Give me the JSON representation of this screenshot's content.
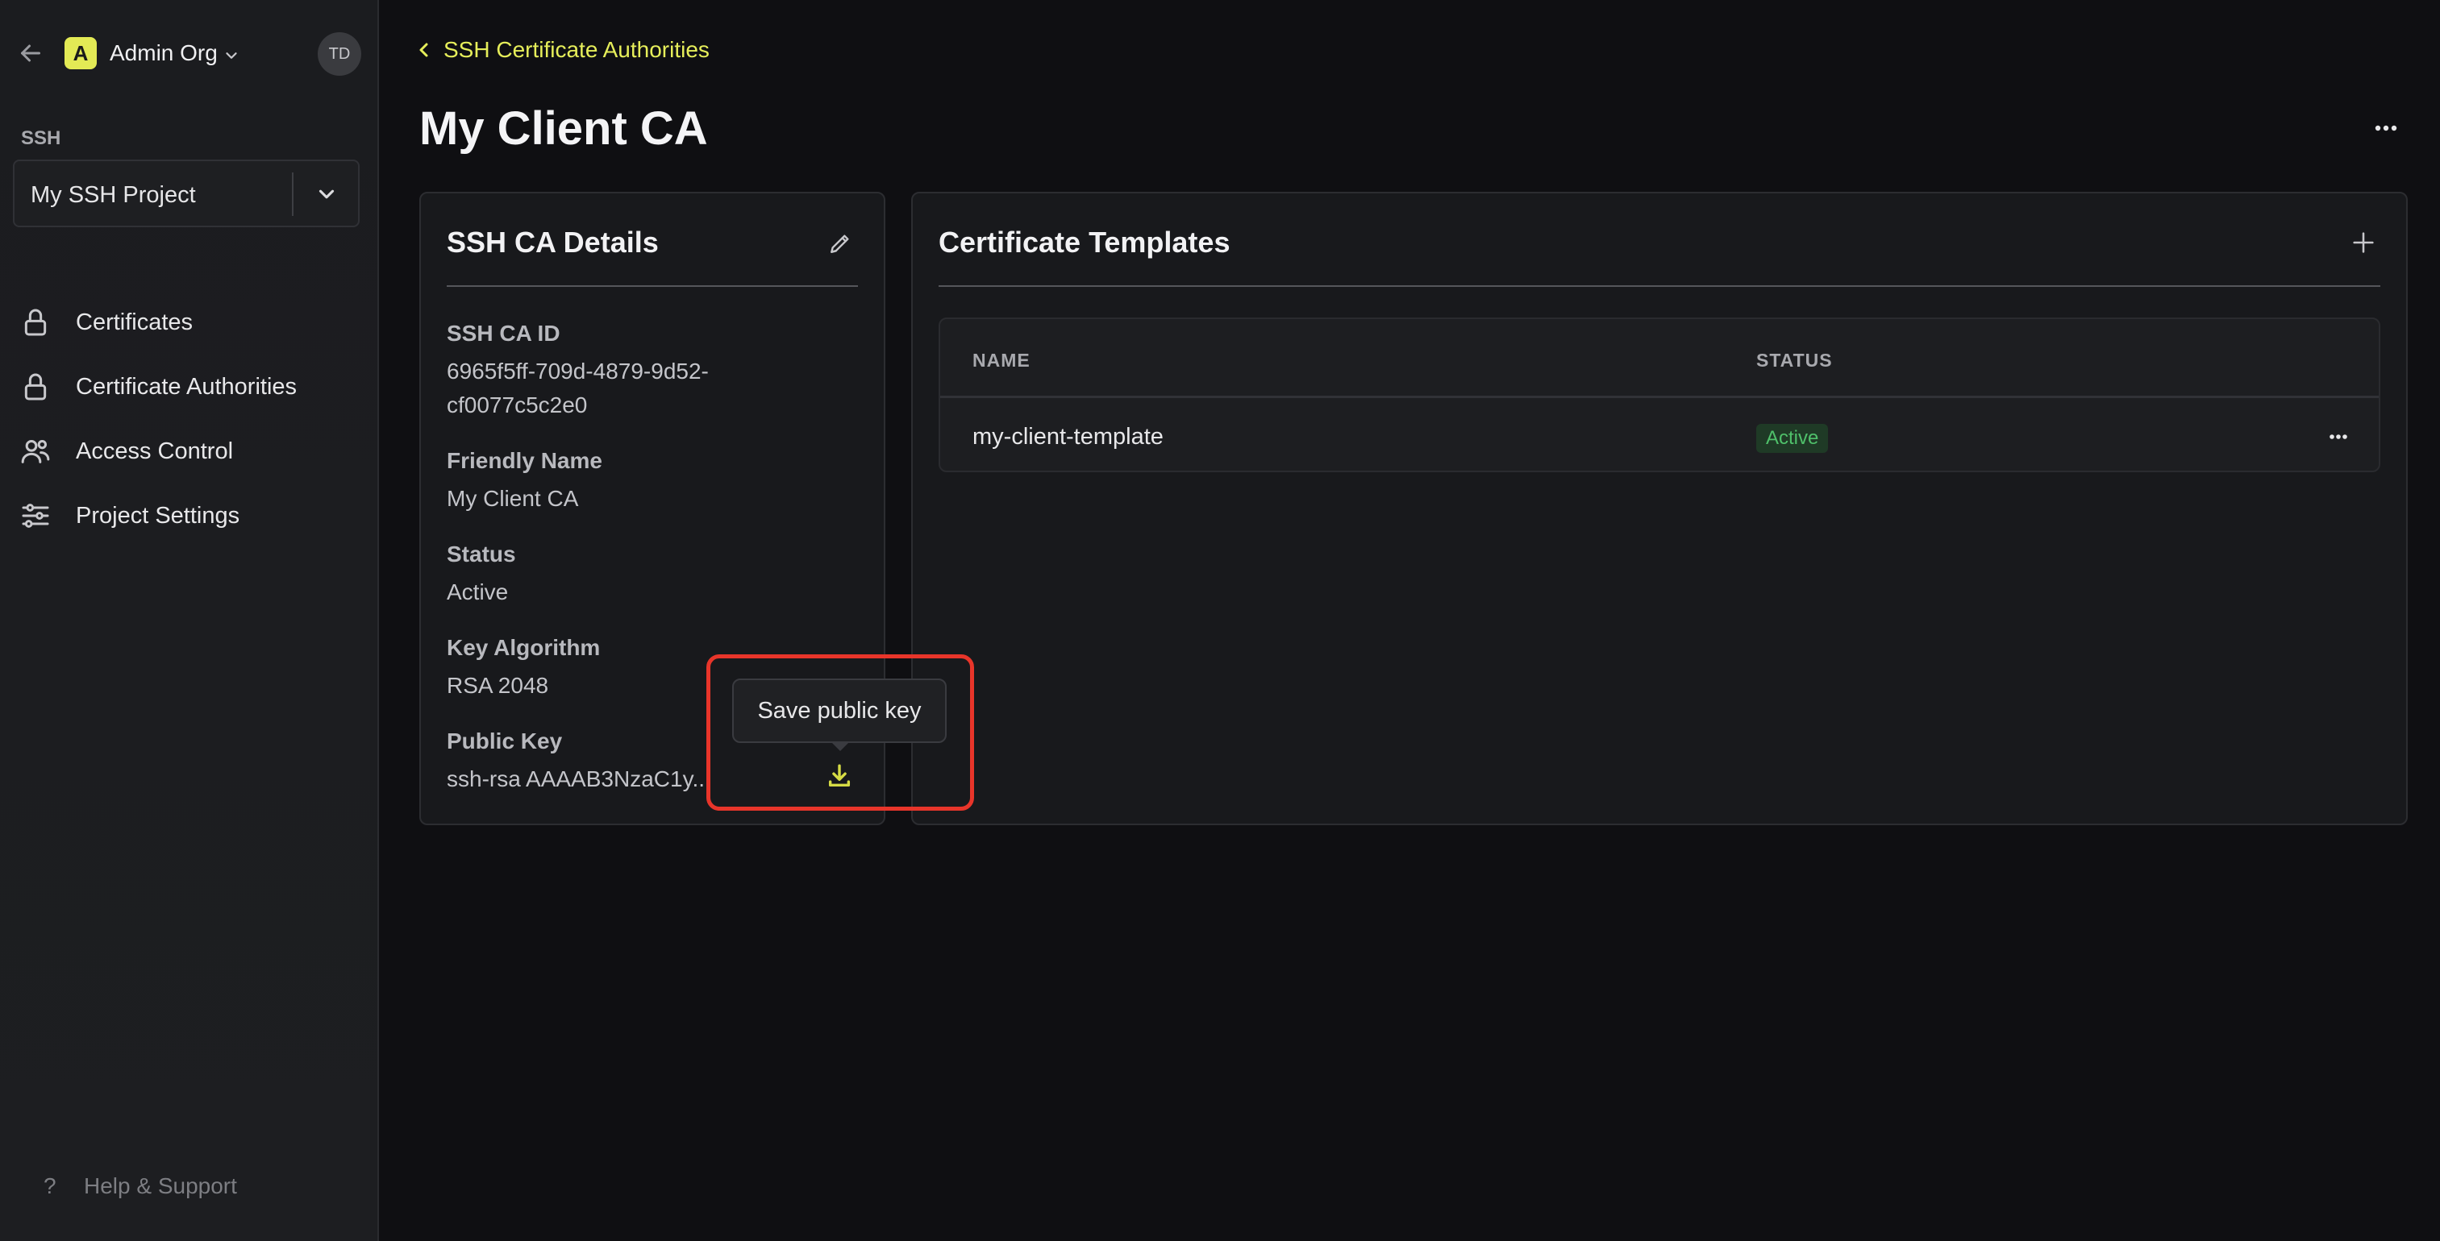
{
  "sidebar": {
    "org_initial": "A",
    "org_name": "Admin Org",
    "user_initials": "TD",
    "section_label": "SSH",
    "project_select_value": "My SSH Project",
    "nav": [
      {
        "label": "Certificates",
        "icon": "lock-icon"
      },
      {
        "label": "Certificate Authorities",
        "icon": "lock-icon"
      },
      {
        "label": "Access Control",
        "icon": "users-icon"
      },
      {
        "label": "Project Settings",
        "icon": "sliders-icon"
      }
    ],
    "help": "Help & Support"
  },
  "breadcrumb": {
    "label": "SSH Certificate Authorities"
  },
  "page": {
    "title": "My Client CA"
  },
  "details": {
    "title": "SSH CA Details",
    "fields": [
      {
        "key": "SSH CA ID",
        "value": "6965f5ff-709d-4879-9d52-cf0077c5c2e0"
      },
      {
        "key": "Friendly Name",
        "value": "My Client CA"
      },
      {
        "key": "Status",
        "value": "Active"
      },
      {
        "key": "Key Algorithm",
        "value": "RSA 2048"
      },
      {
        "key": "Public Key",
        "value": "ssh-rsa AAAAB3NzaC1y..."
      }
    ]
  },
  "templates": {
    "title": "Certificate Templates",
    "columns": [
      "NAME",
      "STATUS"
    ],
    "rows": [
      {
        "name": "my-client-template",
        "status": "Active"
      }
    ]
  },
  "tooltip": {
    "text": "Save public key"
  },
  "colors": {
    "accent": "#e6ee5a",
    "highlight": "#e8352a",
    "status_active": "#4fc06a",
    "background": "#0f0f12"
  }
}
